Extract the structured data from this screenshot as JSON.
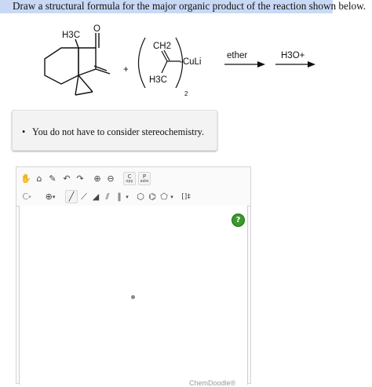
{
  "question": {
    "text": "Draw a structural formula for the major organic product of the reaction shown below."
  },
  "reaction": {
    "ketone_methyl": "H3C",
    "ketone_oxygen": "O",
    "plus": "+",
    "cuprate_vinyl": "CH2",
    "cuprate_metal": "-CuLi",
    "cuprate_methyl": "H3C",
    "cuprate_count": "2",
    "step1_reagent": "ether",
    "step2_reagent": "H3O+"
  },
  "instructions": {
    "bullet": "•",
    "text": "You do not have to consider stereochemistry."
  },
  "editor": {
    "toolbar_row1": [
      "hand-tool",
      "lasso-tool",
      "eraser-tool",
      "undo-arrow",
      "redo-arrow",
      "zoom-in",
      "zoom-out",
      "copy-button",
      "paste-button"
    ],
    "copy_label": "C",
    "copy_sub": "opy",
    "paste_label": "P",
    "paste_sub": "aste",
    "toolbar_row2": [
      "atom-c-menu",
      "charge-plus-menu",
      "single-bond",
      "wedge-bond",
      "bold-wedge",
      "hash-bond",
      "double-bond",
      "triple-bond",
      "bond-menu",
      "cyclohexane",
      "benzene",
      "cyclopentane",
      "ring-menu",
      "bracket-tool"
    ],
    "atom_label": "C",
    "charge_label": "⊕",
    "help_label": "?",
    "brand": "ChemDoodle®"
  }
}
